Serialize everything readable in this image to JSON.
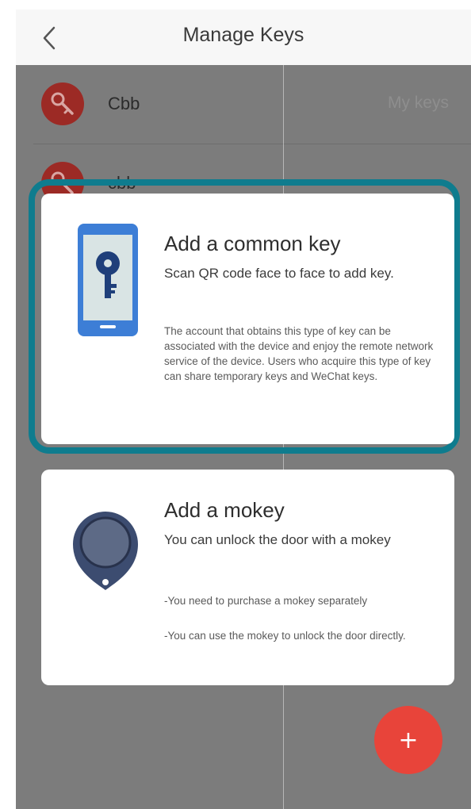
{
  "header": {
    "title": "Manage Keys"
  },
  "key_list": [
    {
      "name": "Cbb",
      "right_label": "My keys"
    },
    {
      "name": "cbb"
    }
  ],
  "common_key_card": {
    "title": "Add a common key",
    "subtitle": "Scan QR code face to face to add key.",
    "description": "The account that obtains this type of key can be associated with the device and enjoy the remote network service of the device. Users who acquire this type of key can share temporary keys and WeChat keys."
  },
  "mokey_card": {
    "title": "Add a mokey",
    "subtitle": "You can unlock the door with a mokey",
    "notes": [
      "-You need to purchase a mokey separately",
      "-You can use the mokey to unlock the door directly."
    ]
  },
  "fab": {
    "label": "+"
  },
  "colors": {
    "accent_red": "#e8443a",
    "highlight_teal": "#0f7c8e",
    "phone_blue": "#3d7ed6",
    "mokey_navy": "#3c4c70"
  },
  "icons": {
    "back": "chevron-left-icon",
    "avatar": "key-icon",
    "common_key": "phone-key-icon",
    "mokey": "mokey-fob-icon"
  }
}
